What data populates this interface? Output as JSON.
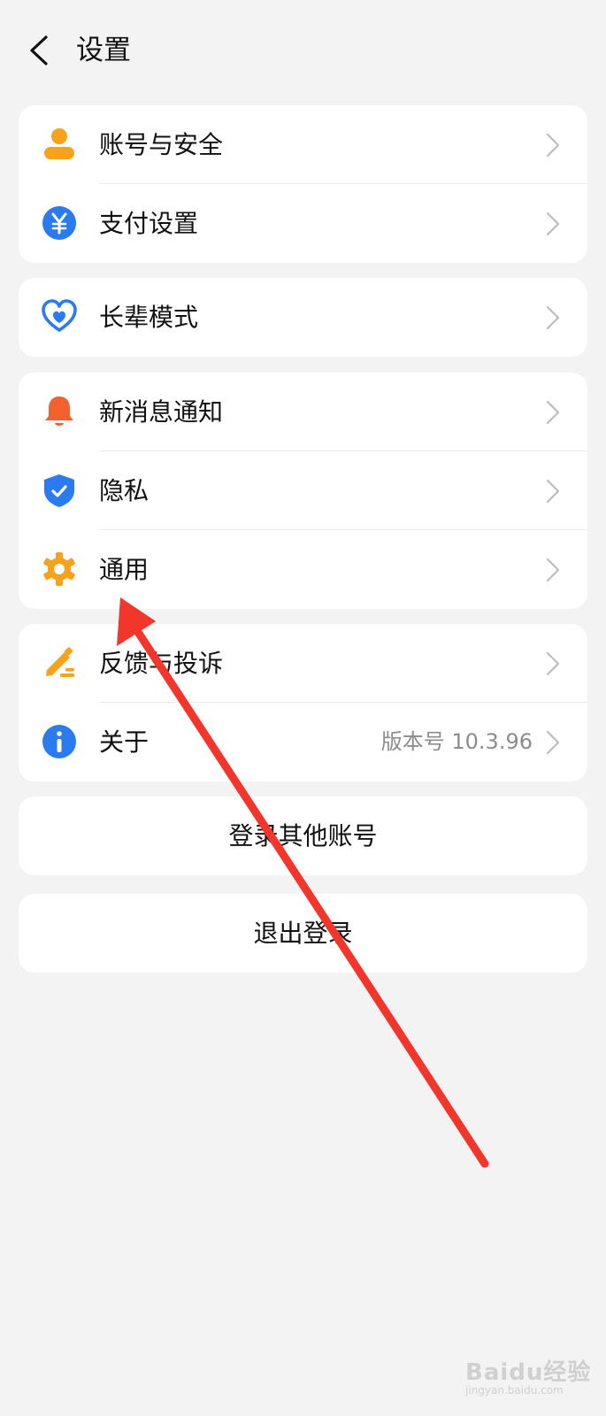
{
  "header": {
    "title": "设置"
  },
  "groups": [
    {
      "items": [
        {
          "label": "账号与安全",
          "icon": "person-icon"
        },
        {
          "label": "支付设置",
          "icon": "yuan-icon"
        }
      ]
    },
    {
      "items": [
        {
          "label": "长辈模式",
          "icon": "heart-icon"
        }
      ]
    },
    {
      "items": [
        {
          "label": "新消息通知",
          "icon": "bell-icon"
        },
        {
          "label": "隐私",
          "icon": "shield-check-icon"
        },
        {
          "label": "通用",
          "icon": "gear-icon"
        }
      ]
    },
    {
      "items": [
        {
          "label": "反馈与投诉",
          "icon": "pencil-icon"
        },
        {
          "label": "关于",
          "icon": "info-icon",
          "value": "版本号 10.3.96"
        }
      ]
    }
  ],
  "buttons": {
    "switch_account": "登录其他账号",
    "logout": "退出登录"
  },
  "watermark": {
    "brand": "Baidu经验",
    "sub": "jingyan.baidu.com"
  },
  "colors": {
    "background": "#f3f3f3",
    "card": "#ffffff",
    "orange": "#f7a21b",
    "blue": "#2a7bf0",
    "bell": "#f4612e",
    "annotation_arrow": "#f2362c"
  }
}
